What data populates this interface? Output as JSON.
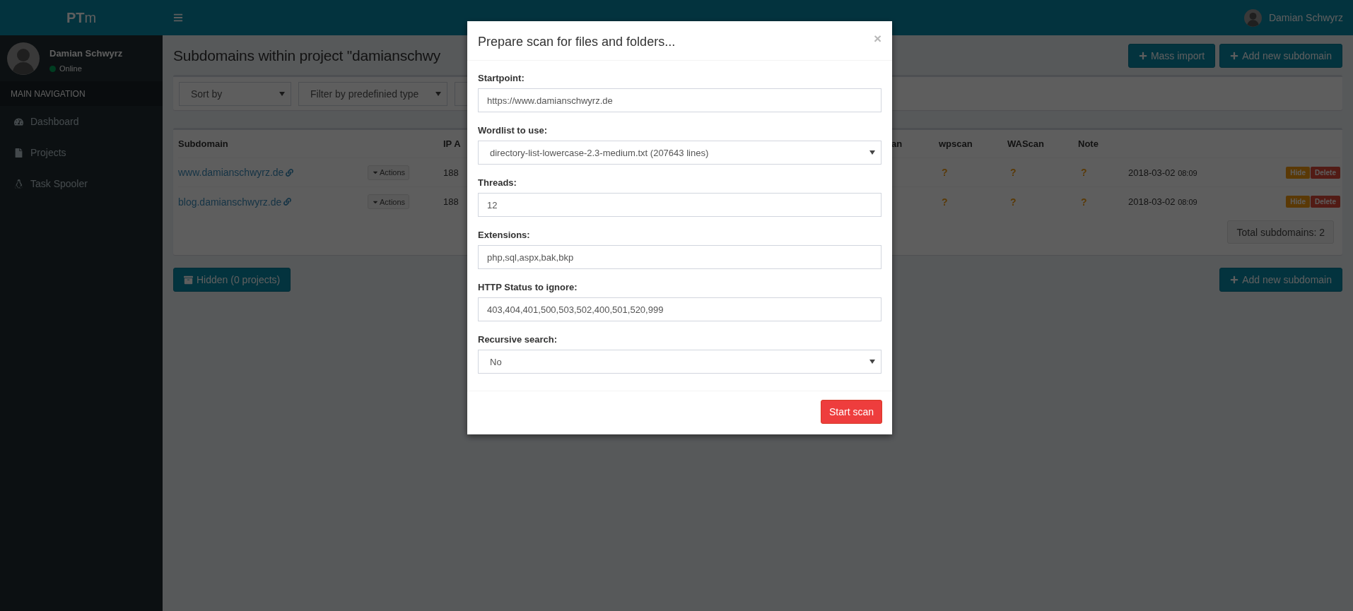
{
  "header": {
    "brand": "**PT**m",
    "user": "Damian Schwyrz"
  },
  "sidebar": {
    "user": {
      "name": "Damian Schwyrz",
      "status": "Online"
    },
    "nav_header": "MAIN NAVIGATION",
    "items": [
      {
        "label": "Dashboard"
      },
      {
        "label": "Projects"
      },
      {
        "label": "Task Spooler"
      }
    ]
  },
  "page": {
    "title": "Subdomains within project \"damianschwy",
    "actions": [
      "Mass import",
      "Add new subdomain"
    ]
  },
  "filters": [
    {
      "placeholder": "Sort by"
    },
    {
      "placeholder": "Filter by predefinied type"
    }
  ],
  "table": {
    "columns": [
      "Subdomain",
      "IP A",
      "an",
      "wpscan",
      "WAScan",
      "Note"
    ],
    "rows": [
      {
        "subdomain": "www.damianschwyrz.de",
        "action": "Actions",
        "column_3": "188",
        "wpscan": "?",
        "wascan": "?",
        "note": "?",
        "date": "2018-03-02",
        "time": "08:09",
        "buttons": [
          "Hide",
          "Delete"
        ]
      },
      {
        "subdomain": "blog.damianschwyrz.de",
        "action": "Actions",
        "column_3": "188",
        "wpscan": "?",
        "wascan": "?",
        "note": "?",
        "date": "2018-03-02",
        "time": "08:09",
        "buttons": [
          "Hide",
          "Delete"
        ]
      }
    ],
    "total": "Total subdomains: 2"
  },
  "footer_actions": {
    "hidden": "Hidden (0 projects)",
    "add": "Add new subdomain"
  },
  "modal": {
    "title": "Prepare scan for files and folders...",
    "close": "×",
    "fields": [
      {
        "label": "Startpoint:",
        "kind": "input",
        "value": "https://www.damianschwyrz.de"
      },
      {
        "label": "Wordlist to use:",
        "kind": "select",
        "value": "directory-list-lowercase-2.3-medium.txt (207643 lines)"
      },
      {
        "label": "Threads:",
        "kind": "input",
        "value": "12"
      },
      {
        "label": "Extensions:",
        "kind": "input",
        "value": "php,sql,aspx,bak,bkp"
      },
      {
        "label": "HTTP Status to ignore:",
        "kind": "input",
        "value": "403,404,401,500,503,502,400,501,520,999"
      },
      {
        "label": "Recursive search:",
        "kind": "select",
        "value": "No"
      }
    ],
    "submit": "Start scan"
  }
}
